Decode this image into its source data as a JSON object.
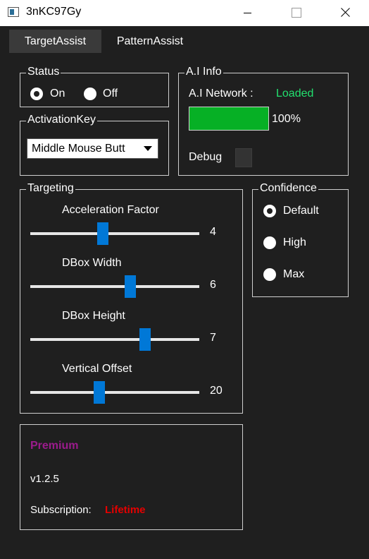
{
  "window": {
    "title": "3nKC97Gy"
  },
  "tabs": [
    {
      "label": "TargetAssist",
      "active": true
    },
    {
      "label": "PatternAssist",
      "active": false
    }
  ],
  "status": {
    "label": "Status",
    "options": [
      {
        "label": "On",
        "checked": true
      },
      {
        "label": "Off",
        "checked": false
      }
    ]
  },
  "activation": {
    "label": "ActivationKey",
    "selected": "Middle Mouse Butt"
  },
  "ai_info": {
    "label": "A.I Info",
    "network_label": "A.I Network :",
    "network_status": "Loaded",
    "status_color": "#22e06e",
    "progress_value": 1.0,
    "progress_text": "100%",
    "debug_label": "Debug"
  },
  "targeting": {
    "label": "Targeting",
    "sliders": [
      {
        "label": "Acceleration Factor",
        "value": "4",
        "fraction": 0.43
      },
      {
        "label": "DBox Width",
        "value": "6",
        "fraction": 0.59
      },
      {
        "label": "DBox Height",
        "value": "7",
        "fraction": 0.68
      },
      {
        "label": "Vertical Offset",
        "value": "20",
        "fraction": 0.41
      }
    ]
  },
  "confidence": {
    "label": "Confidence",
    "options": [
      {
        "label": "Default",
        "checked": true
      },
      {
        "label": "High",
        "checked": false
      },
      {
        "label": "Max",
        "checked": false
      }
    ]
  },
  "info": {
    "premium": "Premium",
    "version": "v1.2.5",
    "subscription_label": "Subscription:",
    "subscription_value": "Lifetime",
    "premium_color": "#9b1b8c",
    "lifetime_color": "#e50000"
  },
  "colors": {
    "accent": "#0078d7",
    "progress": "#06b025",
    "background": "#1f1f1f"
  }
}
